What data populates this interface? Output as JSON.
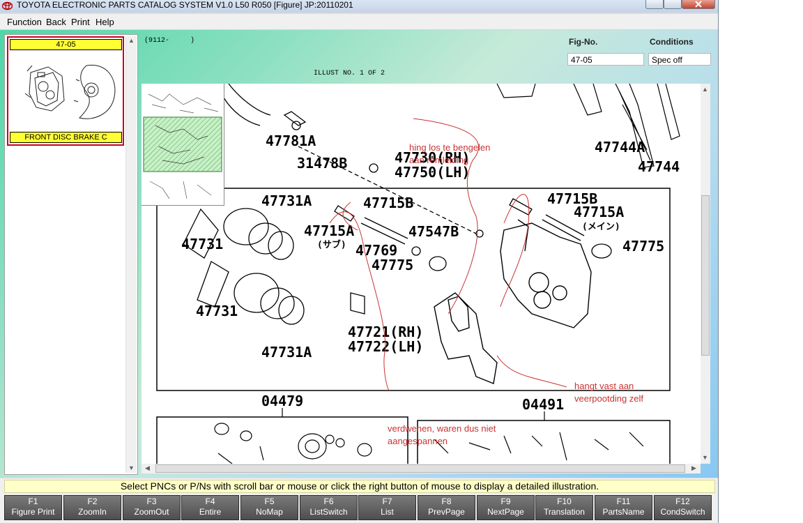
{
  "window": {
    "title": "TOYOTA ELECTRONIC PARTS CATALOG SYSTEM V1.0 L50 R050 [Figure] JP:20110201"
  },
  "menu": [
    "Function",
    "Back",
    "Print",
    "Help"
  ],
  "thumbnail": {
    "label": "47-05",
    "caption": "FRONT DISC BRAKE C"
  },
  "header": {
    "code": "(9112-     )",
    "illust": "ILLUST NO. 1 OF 2",
    "fig_no_label": "Fig-No.",
    "fig_no_value": "47-05",
    "conditions_label": "Conditions",
    "conditions_value": "Spec off"
  },
  "diagram": {
    "part_numbers": [
      "47781A",
      "31478B",
      "47730(RH)",
      "47750(LH)",
      "47744A",
      "47744",
      "47731A",
      "47715B",
      "47731",
      "47715A",
      "(サブ)",
      "47547B",
      "47769",
      "47775",
      "47715B",
      "47715A",
      "(メイン)",
      "47775",
      "47731",
      "47731A",
      "47721(RH)",
      "47722(LH)",
      "04479",
      "04491"
    ],
    "annotations": {
      "note1_line1": "hing los te bengelen",
      "note1_line2": "aan remleiding",
      "note2_line1": "hangt vast aan",
      "note2_line2": "veerpootding zelf",
      "note3_line1": "verdwenen, waren dus niet",
      "note3_line2": "aangespannen"
    }
  },
  "status_message": "Select PNCs or P/Ns with scroll bar or mouse or click the right button of mouse to display a detailed illustration.",
  "function_keys": [
    {
      "key": "F1",
      "label": "Figure Print"
    },
    {
      "key": "F2",
      "label": "ZoomIn"
    },
    {
      "key": "F3",
      "label": "ZoomOut"
    },
    {
      "key": "F4",
      "label": "Entire"
    },
    {
      "key": "F5",
      "label": "NoMap"
    },
    {
      "key": "F6",
      "label": "ListSwitch"
    },
    {
      "key": "F7",
      "label": "List"
    },
    {
      "key": "F8",
      "label": "PrevPage"
    },
    {
      "key": "F9",
      "label": "NextPage"
    },
    {
      "key": "F10",
      "label": "Translation"
    },
    {
      "key": "F11",
      "label": "PartsName"
    },
    {
      "key": "F12",
      "label": "CondSwitch"
    }
  ]
}
